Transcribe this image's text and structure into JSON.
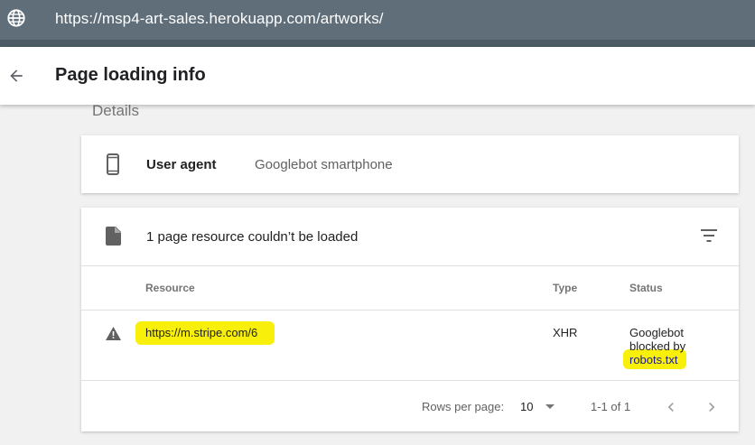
{
  "browser": {
    "url": "https://msp4-art-sales.herokuapp.com/artworks/"
  },
  "header": {
    "title": "Page loading info"
  },
  "section": {
    "label": "Details"
  },
  "user_agent": {
    "label": "User agent",
    "value": "Googlebot smartphone"
  },
  "resources": {
    "title": "1 page resource couldn’t be loaded",
    "columns": {
      "resource": "Resource",
      "type": "Type",
      "status": "Status"
    },
    "rows": [
      {
        "resource": "https://m.stripe.com/6",
        "type": "XHR",
        "status_line1": "Googlebot",
        "status_line2": "blocked by",
        "status_link": "robots.txt"
      }
    ],
    "pagination": {
      "rows_per_page_label": "Rows per page:",
      "rows_per_page": "10",
      "range": "1-1 of 1"
    }
  },
  "colors": {
    "urlbar": "#5f6e79",
    "highlight": "#f8f00a",
    "icon": "#616161"
  },
  "icons": [
    "globe-icon",
    "back-arrow-icon",
    "phone-icon",
    "document-icon",
    "filter-icon",
    "warning-icon",
    "chevron-left-icon",
    "chevron-right-icon",
    "caret-down-icon"
  ]
}
